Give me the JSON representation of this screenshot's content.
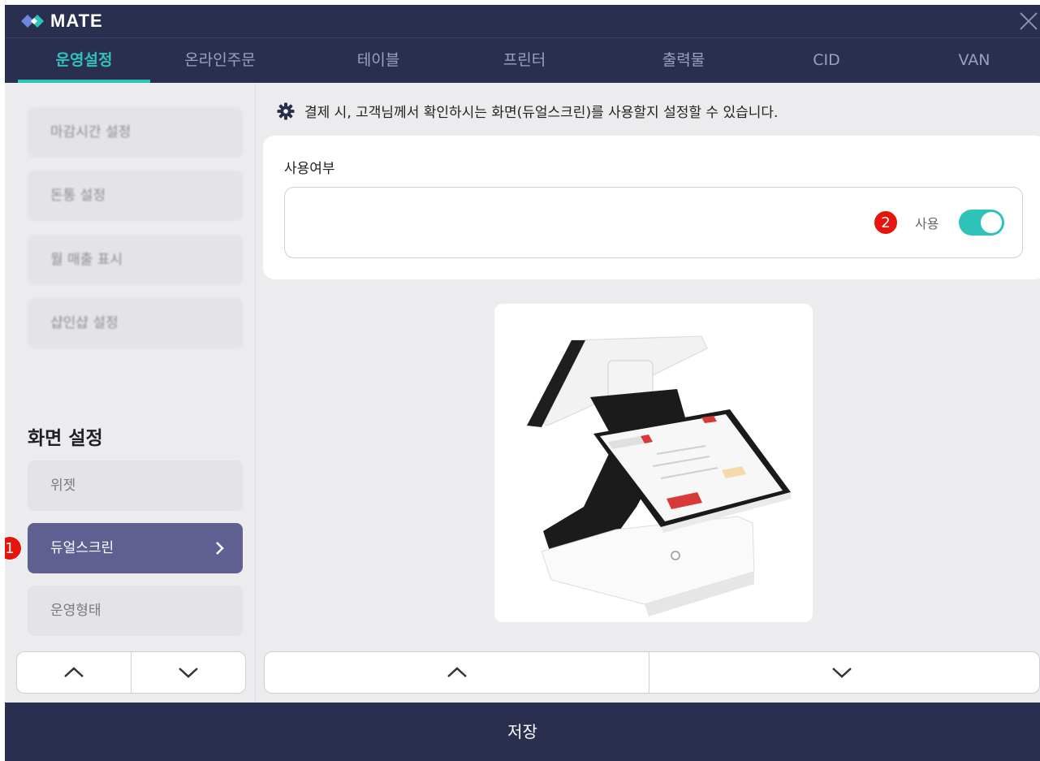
{
  "app": {
    "title": "MATE"
  },
  "tabs": [
    {
      "label": "운영설정",
      "active": true
    },
    {
      "label": "온라인주문"
    },
    {
      "label": "테이블"
    },
    {
      "label": "프린터"
    },
    {
      "label": "출력물"
    },
    {
      "label": "CID"
    },
    {
      "label": "VAN"
    }
  ],
  "sidebar": {
    "items_top": [
      {
        "label": "마감시간 설정"
      },
      {
        "label": "돈통 설정"
      },
      {
        "label": "월 매출 표시"
      },
      {
        "label": "샵인샵 설정"
      }
    ],
    "section_title": "화면 설정",
    "items_screen": [
      {
        "label": "위젯"
      },
      {
        "label": "듀얼스크린",
        "active": true
      },
      {
        "label": "운영형태"
      }
    ]
  },
  "markers": {
    "m1": "1",
    "m2": "2"
  },
  "main": {
    "info": "결제 시, 고객님께서 확인하시는 화면(듀얼스크린)를 사용할지 설정할 수 있습니다.",
    "usage_label": "사용여부",
    "toggle_label": "사용",
    "toggle_on": true
  },
  "footer": {
    "save_label": "저장"
  },
  "colors": {
    "header_bg": "#2a2f4f",
    "accent": "#2ec3b8",
    "active_item": "#5f6091",
    "marker": "#e5140d"
  }
}
